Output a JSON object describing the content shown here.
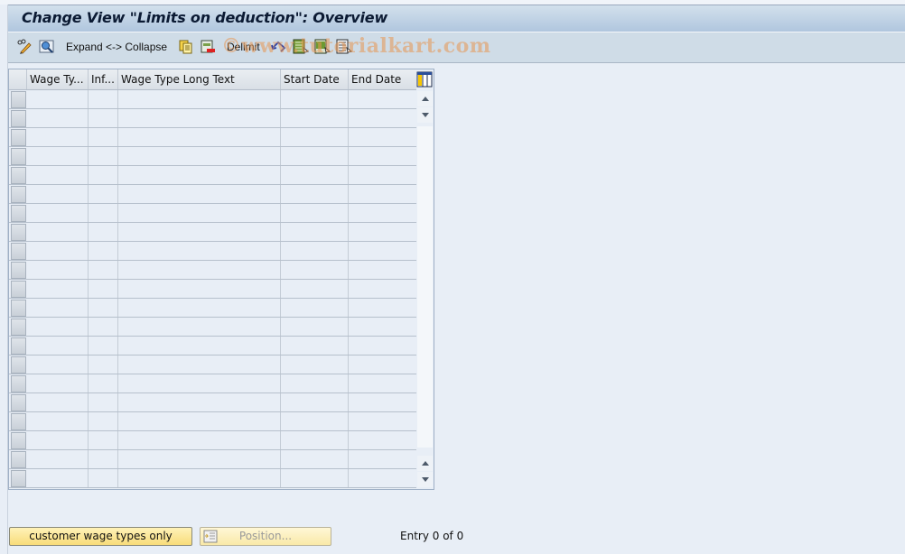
{
  "window": {
    "title": "Change View \"Limits on deduction\": Overview"
  },
  "toolbar": {
    "items": [
      {
        "name": "display-change-toggle",
        "icon": "pencil-glasses-icon"
      },
      {
        "name": "find",
        "icon": "search-icon"
      },
      {
        "name": "expand-collapse",
        "label": "Expand <-> Collapse"
      },
      {
        "name": "copy-as",
        "icon": "copy-icon"
      },
      {
        "name": "delete",
        "icon": "delete-icon"
      },
      {
        "name": "delimit",
        "label": "Delimit"
      },
      {
        "name": "undo-change",
        "icon": "undo-icon"
      },
      {
        "name": "select-all",
        "icon": "select-all-icon"
      },
      {
        "name": "select-block",
        "icon": "select-block-icon"
      },
      {
        "name": "deselect-all",
        "icon": "deselect-all-icon"
      }
    ],
    "watermark": "©www.tutorialkart.com"
  },
  "table": {
    "columns": [
      {
        "key": "wage_type",
        "label": "Wage Ty..."
      },
      {
        "key": "inf",
        "label": "Inf..."
      },
      {
        "key": "long_text",
        "label": "Wage Type Long Text"
      },
      {
        "key": "start_date",
        "label": "Start Date"
      },
      {
        "key": "end_date",
        "label": "End Date"
      }
    ],
    "rows": [],
    "visible_empty_rows": 21,
    "settings_icon": "table-settings-icon"
  },
  "footer": {
    "customer_button": "customer wage types only",
    "position_button": "Position...",
    "entry_status": "Entry 0 of 0"
  }
}
